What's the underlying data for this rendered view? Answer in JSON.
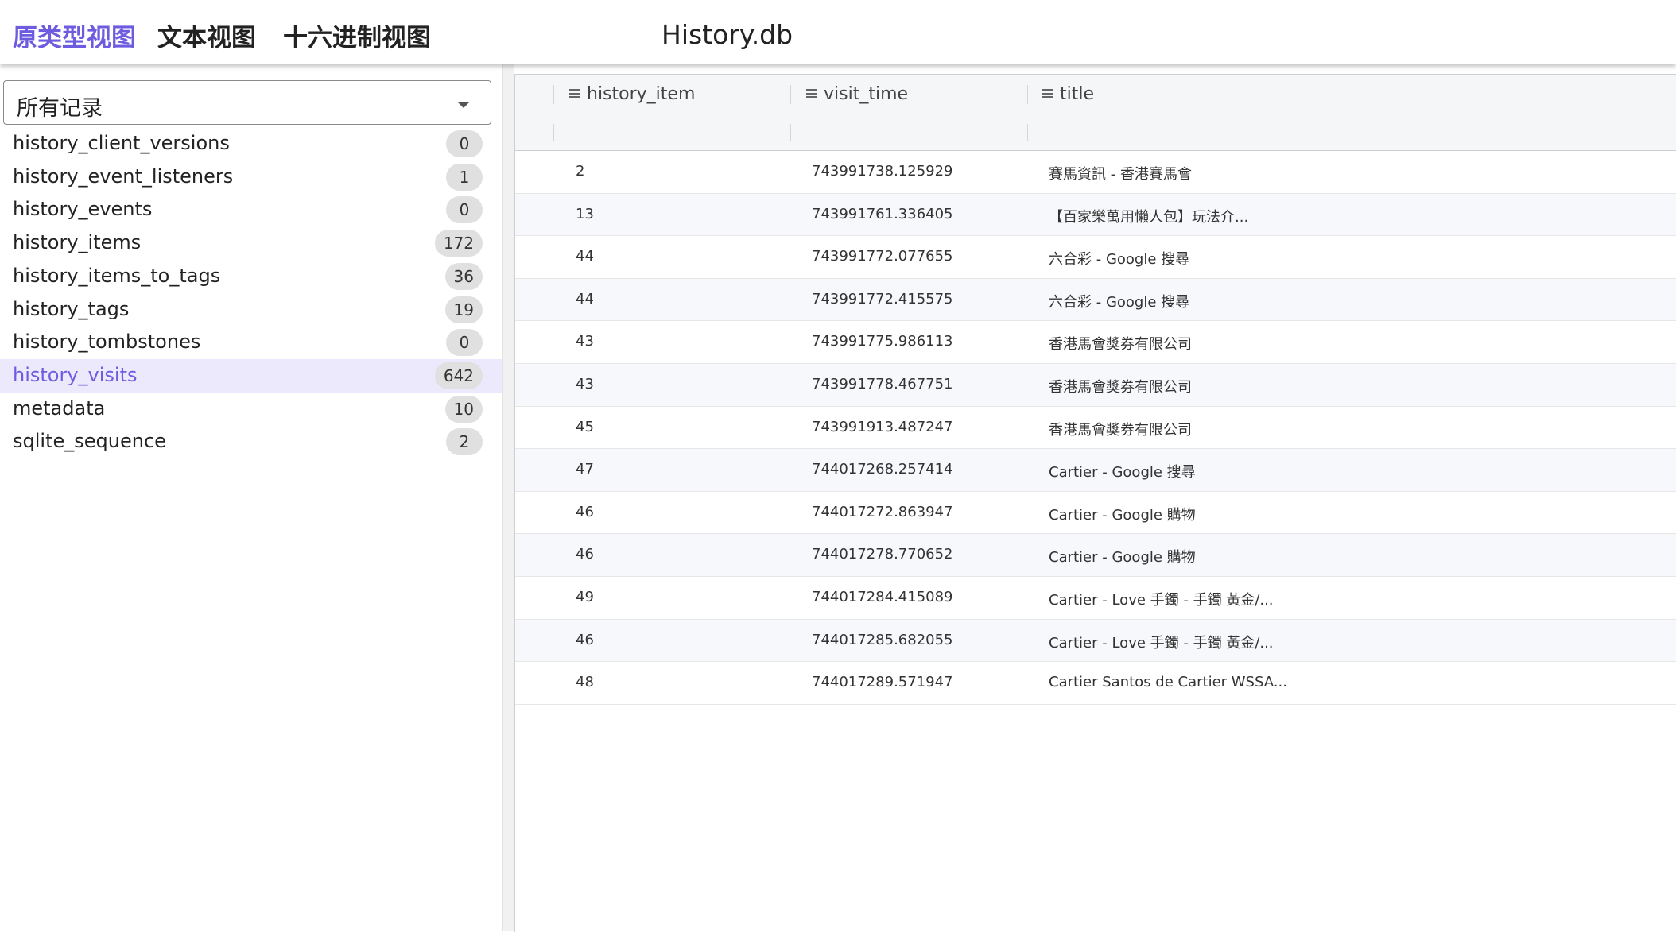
{
  "tabs": [
    {
      "label": "原类型视图",
      "active": true
    },
    {
      "label": "文本视图",
      "active": false
    },
    {
      "label": "十六进制视图",
      "active": false
    }
  ],
  "file_name": "History.db",
  "sidebar": {
    "select_value": "所有记录",
    "tables": [
      {
        "name": "history_client_versions",
        "count": "0"
      },
      {
        "name": "history_event_listeners",
        "count": "1"
      },
      {
        "name": "history_events",
        "count": "0"
      },
      {
        "name": "history_items",
        "count": "172"
      },
      {
        "name": "history_items_to_tags",
        "count": "36"
      },
      {
        "name": "history_tags",
        "count": "19"
      },
      {
        "name": "history_tombstones",
        "count": "0"
      },
      {
        "name": "history_visits",
        "count": "642",
        "active": true
      },
      {
        "name": "metadata",
        "count": "10"
      },
      {
        "name": "sqlite_sequence",
        "count": "2"
      }
    ]
  },
  "grid": {
    "columns": [
      "history_item",
      "visit_time",
      "title"
    ],
    "rows": [
      [
        "2",
        "743991738.125929",
        "賽馬資訊 - 香港賽馬會"
      ],
      [
        "13",
        "743991761.336405",
        "【百家樂萬用懶人包】玩法介..."
      ],
      [
        "44",
        "743991772.077655",
        "六合彩 - Google 搜尋"
      ],
      [
        "44",
        "743991772.415575",
        "六合彩 - Google 搜尋"
      ],
      [
        "43",
        "743991775.986113",
        "香港馬會獎券有限公司"
      ],
      [
        "43",
        "743991778.467751",
        "香港馬會獎券有限公司"
      ],
      [
        "45",
        "743991913.487247",
        "香港馬會獎券有限公司"
      ],
      [
        "47",
        "744017268.257414",
        "Cartier - Google 搜尋"
      ],
      [
        "46",
        "744017272.863947",
        "Cartier - Google 購物"
      ],
      [
        "46",
        "744017278.770652",
        "Cartier - Google 購物"
      ],
      [
        "49",
        "744017284.415089",
        "Cartier - Love 手鐲 - 手鐲 黃金/..."
      ],
      [
        "46",
        "744017285.682055",
        "Cartier - Love 手鐲 - 手鐲 黃金/..."
      ],
      [
        "48",
        "744017289.571947",
        "Cartier Santos de Cartier WSSA..."
      ]
    ]
  },
  "colors": {
    "accent": "#6e5ce0",
    "active_row_bg": "#ebe9fb",
    "badge_bg": "#e0e0e0"
  },
  "icons": {
    "column_header": "list-icon",
    "select": "caret-down-icon"
  }
}
